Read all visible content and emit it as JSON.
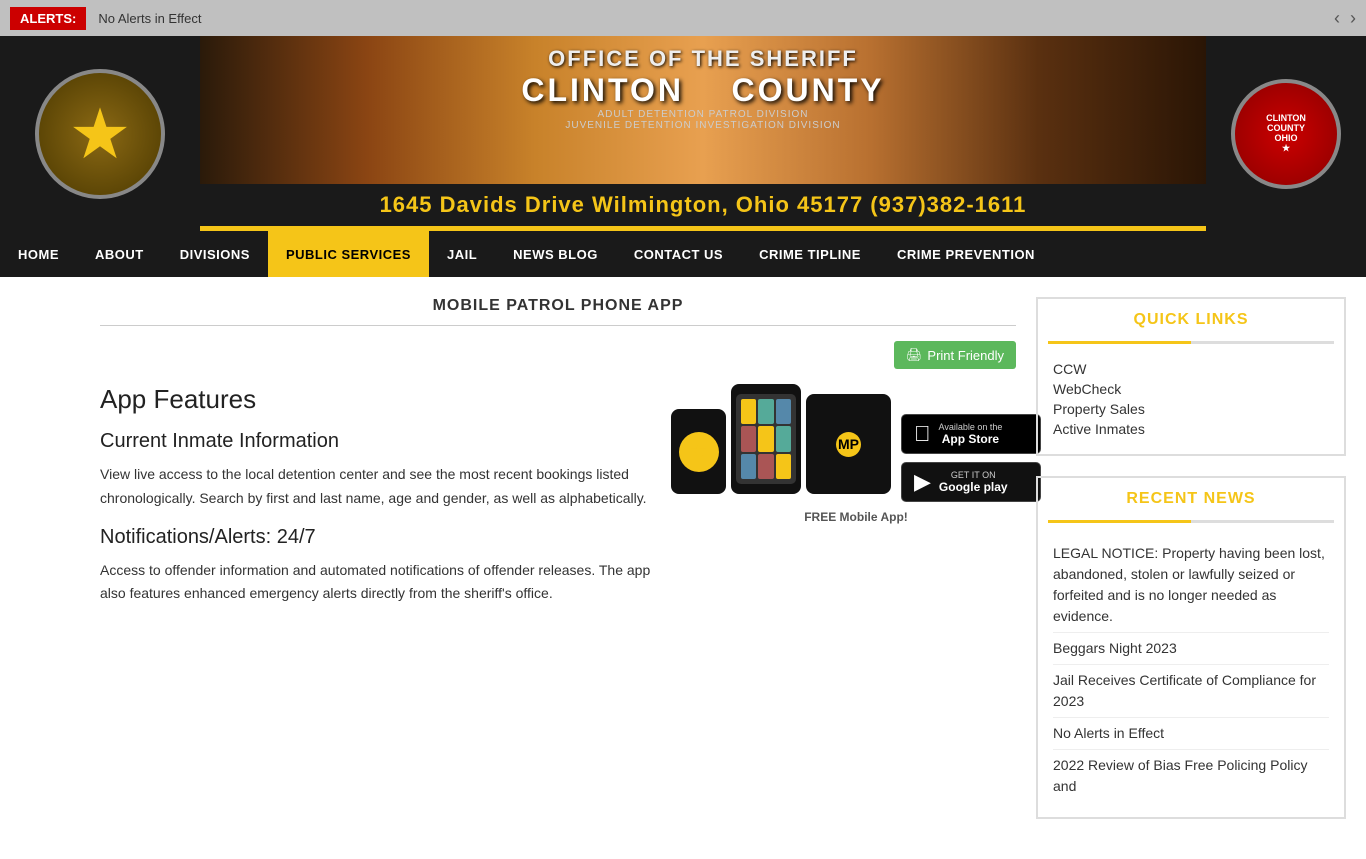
{
  "alerts": {
    "label": "ALERTS:",
    "message": "No Alerts in Effect"
  },
  "header": {
    "address": "1645 Davids Drive   Wilmington, Ohio 45177   (937)382-1611",
    "banner": {
      "line1": "OFFICE OF THE SHERIFF",
      "line2": "CLINTON",
      "line3": "COUNTY",
      "line4": "ADULT DETENTION   PATROL DIVISION",
      "line5": "JUVENILE DETENTION   INVESTIGATION DIVISION"
    },
    "logo_left_alt": "Clinton County Sheriff's Office Badge",
    "logo_right_alt": "Clinton County Sheriff's Office Seal"
  },
  "nav": {
    "items": [
      {
        "label": "HOME",
        "active": false
      },
      {
        "label": "ABOUT",
        "active": false
      },
      {
        "label": "DIVISIONS",
        "active": false
      },
      {
        "label": "PUBLIC SERVICES",
        "active": true
      },
      {
        "label": "JAIL",
        "active": false
      },
      {
        "label": "NEWS BLOG",
        "active": false
      },
      {
        "label": "CONTACT US",
        "active": false
      },
      {
        "label": "CRIME TIPLINE",
        "active": false
      },
      {
        "label": "CRIME PREVENTION",
        "active": false
      }
    ]
  },
  "page": {
    "title": "MOBILE PATROL PHONE APP",
    "print_button": "Print Friendly",
    "app_features_heading": "App Features",
    "free_app_text": "FREE Mobile App!",
    "app_store_label": "Available on the",
    "app_store_name": "App Store",
    "google_play_label": "GET IT ON",
    "google_play_name": "Google play",
    "sections": [
      {
        "heading": "Current Inmate Information",
        "body": "View live access to the local detention center and see the most recent bookings listed chronologically. Search by first and last name, age and gender, as well as alphabetically."
      },
      {
        "heading": "Notifications/Alerts: 24/7",
        "body": "Access to offender information and automated notifications of offender releases. The app also features enhanced emergency alerts directly from the sheriff's office."
      }
    ]
  },
  "sidebar": {
    "quick_links": {
      "title": "QUICK LINKS",
      "links": [
        "CCW",
        "WebCheck",
        "Property Sales",
        "Active Inmates"
      ]
    },
    "recent_news": {
      "title": "RECENT NEWS",
      "items": [
        "LEGAL NOTICE: Property having been lost, abandoned, stolen or lawfully seized or forfeited and is no longer needed as evidence.",
        "Beggars Night 2023",
        "Jail Receives Certificate of Compliance for 2023",
        "No Alerts in Effect",
        "2022 Review of Bias Free Policing Policy and"
      ]
    }
  }
}
